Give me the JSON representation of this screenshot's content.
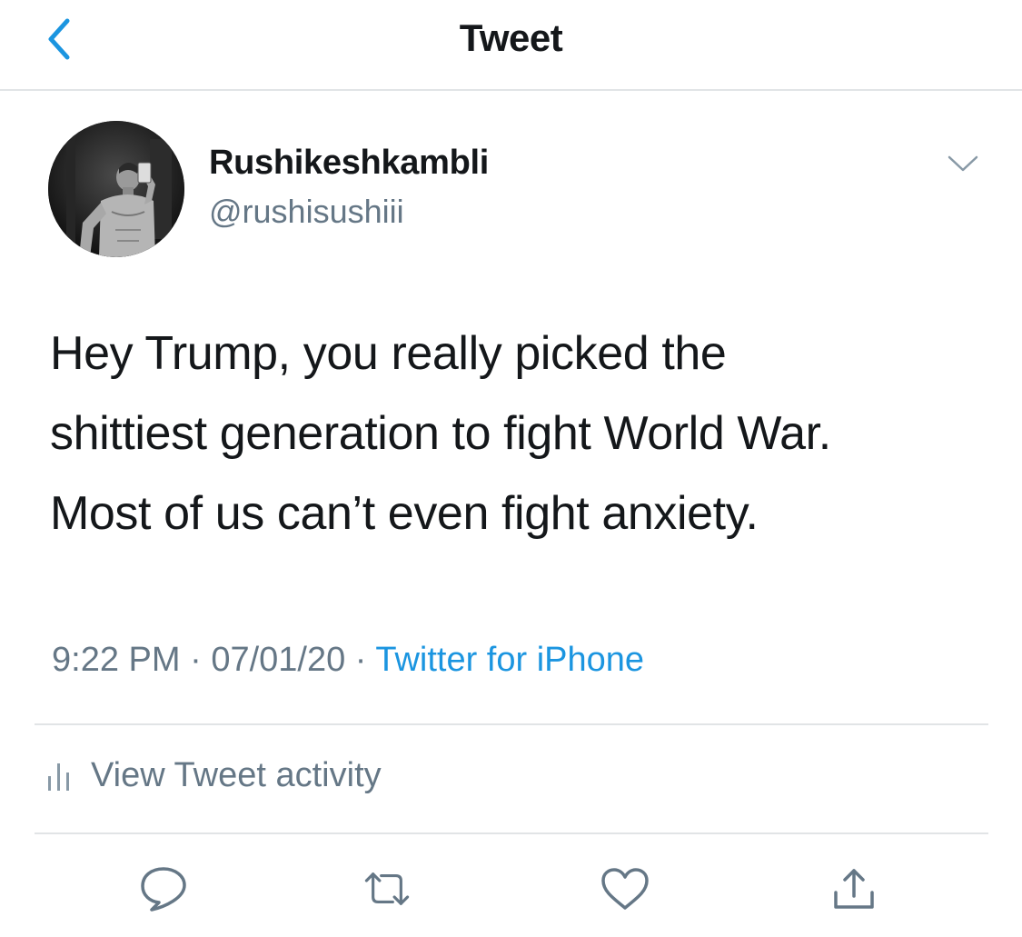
{
  "navbar": {
    "title": "Tweet",
    "back_icon": "chevron-left-icon"
  },
  "tweet": {
    "author": {
      "display_name": "Rushikeshkambli",
      "handle": "@rushisushiii"
    },
    "text_lines": [
      "Hey Trump, you really picked the",
      "shittiest generation to fight World War.",
      "Most of us can’t even fight anxiety."
    ],
    "time": "9:22 PM",
    "separator": "·",
    "date": "07/01/20",
    "source": "Twitter for iPhone"
  },
  "activity": {
    "label": "View Tweet activity",
    "icon": "bar-chart-icon"
  },
  "actions": {
    "reply_icon": "reply-icon",
    "retweet_icon": "retweet-icon",
    "like_icon": "heart-icon",
    "share_icon": "share-icon"
  },
  "colors": {
    "accent": "#1b95e0",
    "secondary_text": "#657786",
    "divider": "#e1e4e6"
  }
}
